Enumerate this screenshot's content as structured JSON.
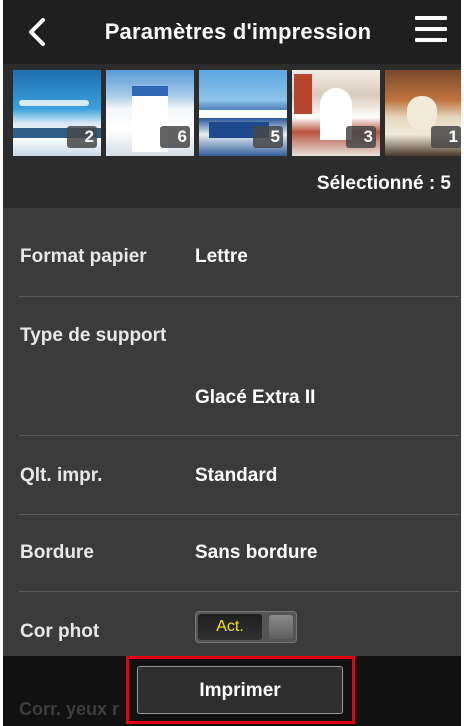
{
  "header": {
    "title": "Paramètres d'impression",
    "back_icon": "chevron-left-icon",
    "menu_icon": "hamburger-menu-icon"
  },
  "thumbnails": [
    {
      "count": "2"
    },
    {
      "count": "6"
    },
    {
      "count": "5"
    },
    {
      "count": "3"
    },
    {
      "count": "1"
    }
  ],
  "selection": {
    "text": "Sélectionné : 5"
  },
  "settings": {
    "paper_size": {
      "label": "Format papier",
      "value": "Lettre"
    },
    "media_type": {
      "label": "Type de support",
      "value": "Glacé Extra II"
    },
    "print_quality": {
      "label": "Qlt. impr.",
      "value": "Standard"
    },
    "border": {
      "label": "Bordure",
      "value": "Sans bordure"
    },
    "photo_fix": {
      "label": "Cor phot",
      "toggle_label": "Act.",
      "toggle_on": true
    }
  },
  "partial_row": {
    "label": "Corr. yeux r"
  },
  "actions": {
    "print_label": "Imprimer"
  },
  "colors": {
    "header_bg": "#1f1f1f",
    "panel_bg": "#3b3b3b",
    "toggle_text": "#f2e600",
    "highlight": "#e3000f"
  }
}
